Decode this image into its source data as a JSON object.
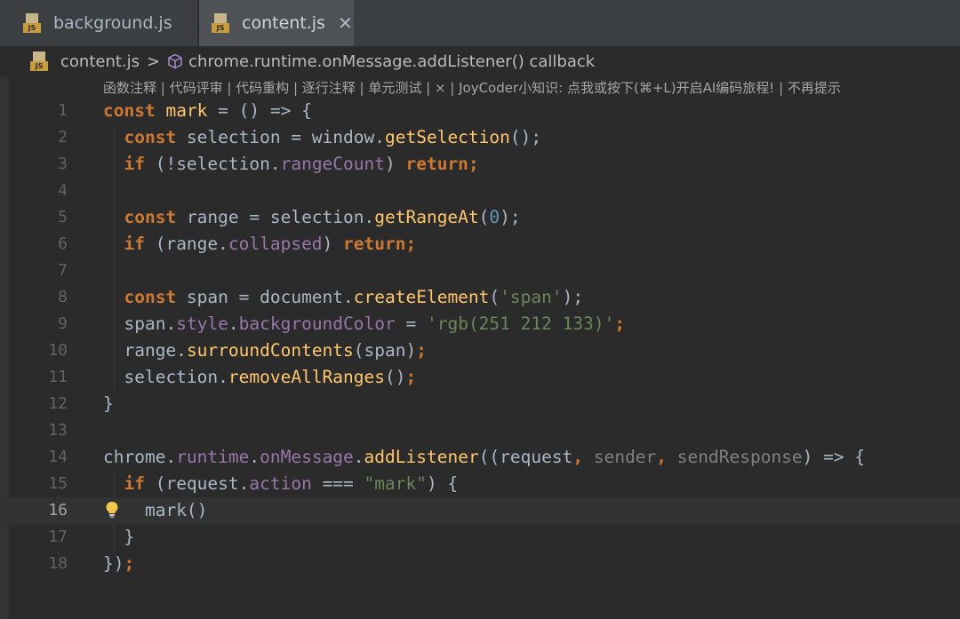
{
  "tabs": [
    {
      "label": "background.js",
      "icon": "js-file-icon",
      "active": false
    },
    {
      "label": "content.js",
      "icon": "js-file-icon",
      "active": true,
      "close": "✕"
    }
  ],
  "breadcrumb": {
    "file": "content.js",
    "separator": ">",
    "symbol": "chrome.runtime.onMessage.addListener() callback"
  },
  "code_lens": "函数注释 | 代码评审 | 代码重构 | 逐行注释 | 单元测试 | × | JoyCoder小知识: 点我或按下(⌘+L)开启AI编码旅程! | 不再提示",
  "editor": {
    "current_line": 16,
    "lines": [
      {
        "n": "1"
      },
      {
        "n": "2"
      },
      {
        "n": "3"
      },
      {
        "n": "4"
      },
      {
        "n": "5"
      },
      {
        "n": "6"
      },
      {
        "n": "7"
      },
      {
        "n": "8"
      },
      {
        "n": "9"
      },
      {
        "n": "10"
      },
      {
        "n": "11"
      },
      {
        "n": "12"
      },
      {
        "n": "13"
      },
      {
        "n": "14"
      },
      {
        "n": "15"
      },
      {
        "n": "16"
      },
      {
        "n": "17"
      },
      {
        "n": "18"
      }
    ]
  },
  "code": {
    "l1": [
      "const",
      "mark",
      " = () => {"
    ],
    "l2": [
      "const",
      " selection = window.",
      "getSelection",
      "();"
    ],
    "l3": [
      "if",
      " (!selection.",
      "rangeCount",
      ") ",
      "return",
      ";"
    ],
    "l5": [
      "const",
      " range = selection.",
      "getRangeAt",
      "(",
      "0",
      ");"
    ],
    "l6": [
      "if",
      " (range.",
      "collapsed",
      ") ",
      "return",
      ";"
    ],
    "l8": [
      "const",
      " span = document.",
      "createElement",
      "(",
      "'span'",
      ");"
    ],
    "l9": [
      "span.",
      "style",
      ".",
      "backgroundColor",
      " = ",
      "'rgb(251 212 133)'",
      ";"
    ],
    "l10": [
      "range.",
      "surroundContents",
      "(span)",
      ";"
    ],
    "l11": [
      "selection.",
      "removeAllRanges",
      "()",
      ";"
    ],
    "l12": [
      "}"
    ],
    "l14": [
      "chrome.",
      "runtime",
      ".",
      "onMessage",
      ".",
      "addListener",
      "((request",
      ", ",
      "sender",
      ", ",
      "sendResponse",
      ") => {"
    ],
    "l15": [
      "if",
      " (request.",
      "action",
      " === ",
      "\"mark\"",
      ") {"
    ],
    "l16": [
      "mark()"
    ],
    "l17": [
      "}"
    ],
    "l18": [
      "})",
      ";"
    ]
  },
  "colors": {
    "keyword": "#cc7832",
    "function": "#ffc66d",
    "property": "#9876aa",
    "string": "#6a8759",
    "number": "#6897bb",
    "text": "#a9b7c6",
    "background": "#2b2b2b"
  }
}
